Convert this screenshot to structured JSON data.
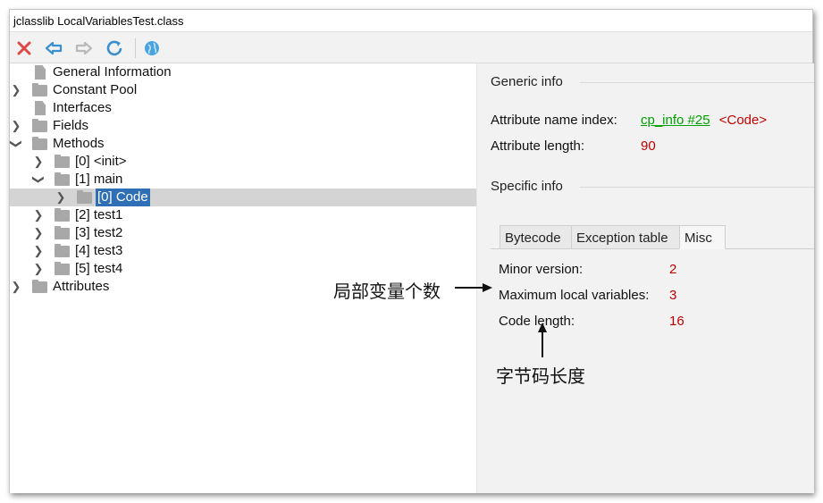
{
  "window": {
    "title": "jclasslib LocalVariablesTest.class"
  },
  "toolbar": {
    "buttons": [
      {
        "name": "close",
        "icon": "close-icon"
      },
      {
        "name": "back",
        "icon": "back-arrow-icon"
      },
      {
        "name": "forward",
        "icon": "forward-arrow-icon"
      },
      {
        "name": "reload",
        "icon": "reload-icon"
      },
      {
        "name": "browser",
        "icon": "globe-icon"
      }
    ]
  },
  "tree": {
    "general": "General Information",
    "constant_pool": "Constant Pool",
    "interfaces": "Interfaces",
    "fields": "Fields",
    "methods": "Methods",
    "m0": "[0] <init>",
    "m1": "[1] main",
    "m1_code": "[0] Code",
    "m2": "[2] test1",
    "m3": "[3] test2",
    "m4": "[4] test3",
    "m5": "[5] test4",
    "attributes": "Attributes"
  },
  "generic": {
    "title": "Generic info",
    "name_index_label": "Attribute name index:",
    "name_index_link": "cp_info #25",
    "name_index_value": "<Code>",
    "length_label": "Attribute length:",
    "length_value": "90"
  },
  "specific": {
    "title": "Specific info",
    "tabs": [
      "Bytecode",
      "Exception table",
      "Misc"
    ],
    "active_tab": "Misc",
    "minor_label": "Minor version:",
    "minor_value": "2",
    "max_locals_label": "Maximum local variables:",
    "max_locals_value": "3",
    "code_length_label": "Code length:",
    "code_length_value": "16"
  },
  "annotations": {
    "max_locals": "局部变量个数",
    "code_length": "字节码长度"
  },
  "colors": {
    "value_red": "#c00000",
    "link_green": "#00a000",
    "selection": "#2f6fb6"
  }
}
